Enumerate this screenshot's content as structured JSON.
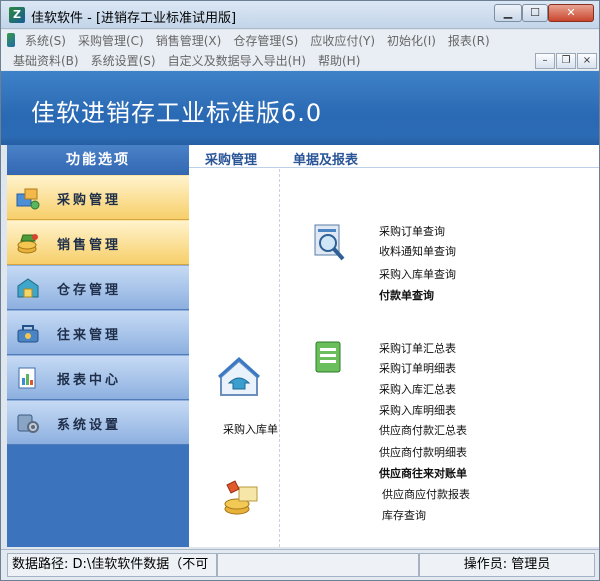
{
  "window": {
    "title": "佳软软件 - [进销存工业标准试用版]",
    "controls": {
      "minimize": "▁",
      "maximize": "☐",
      "close": "✕"
    },
    "icon": "app-logo-icon"
  },
  "menu": {
    "row1": [
      "系统(S)",
      "采购管理(C)",
      "销售管理(X)",
      "仓存管理(S)",
      "应收应付(Y)",
      "初始化(I)",
      "报表(R)"
    ],
    "row2": [
      "基础资料(B)",
      "系统设置(S)",
      "自定义及数据导入导出(H)",
      "帮助(H)"
    ],
    "mdi": {
      "minimize": "–",
      "restore": "❐",
      "close": "×"
    }
  },
  "banner": {
    "title": "佳软进销存工业标准版6.0"
  },
  "sidebar": {
    "heading": "功能选项",
    "items": [
      {
        "label": "采购管理",
        "icon": "purchase-icon",
        "active": true
      },
      {
        "label": "销售管理",
        "icon": "sales-icon",
        "active": true
      },
      {
        "label": "仓存管理",
        "icon": "warehouse-icon",
        "active": false
      },
      {
        "label": "往来管理",
        "icon": "accounts-icon",
        "active": false
      },
      {
        "label": "报表中心",
        "icon": "report-icon",
        "active": false
      },
      {
        "label": "系统设置",
        "icon": "settings-icon",
        "active": false
      }
    ]
  },
  "content": {
    "head_left": "采购管理",
    "head_right": "单据及报表",
    "left_items": [
      {
        "label": "采购入库单",
        "icon": "purchase-receipt-icon"
      },
      {
        "label": "",
        "icon": "coins-icon"
      }
    ],
    "query_group": [
      "采购订单查询",
      "收料通知单查询",
      "采购入库单查询",
      "付款单查询"
    ],
    "report_group": [
      "采购订单汇总表",
      "采购订单明细表",
      "采购入库汇总表",
      "采购入库明细表",
      "供应商付款汇总表",
      "供应商付款明细表",
      "供应商往来对账单",
      "供应商应付款报表",
      "库存查询"
    ],
    "bold_items": [
      "付款单查询",
      "供应商往来对账单"
    ]
  },
  "status": {
    "data_path": "数据路径: D:\\佳软软件数据（不可",
    "middle": "",
    "operator": "操作员: 管理员"
  }
}
